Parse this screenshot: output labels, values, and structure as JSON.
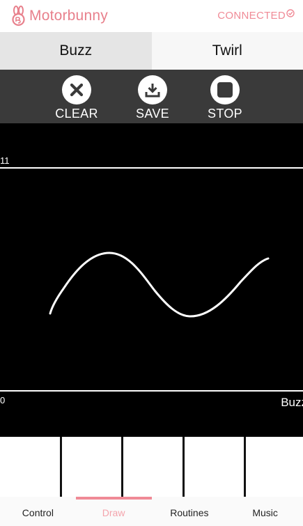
{
  "app": {
    "name": "Motorbunny",
    "status": "CONNECTED",
    "brand_color": "#e8808c"
  },
  "tabs": [
    {
      "label": "Buzz",
      "active": true
    },
    {
      "label": "Twirl",
      "active": false
    }
  ],
  "toolbar": {
    "clear_label": "CLEAR",
    "save_label": "SAVE",
    "stop_label": "STOP",
    "icons": [
      "close-icon",
      "download-icon",
      "stop-icon"
    ]
  },
  "canvas": {
    "max_label": "11",
    "min_label": "0",
    "mode_label": "Buzz"
  },
  "keys": {
    "count": 5
  },
  "bottom_nav": [
    {
      "label": "Control",
      "active": false
    },
    {
      "label": "Draw",
      "active": true
    },
    {
      "label": "Routines",
      "active": false
    },
    {
      "label": "Music",
      "active": false
    }
  ]
}
